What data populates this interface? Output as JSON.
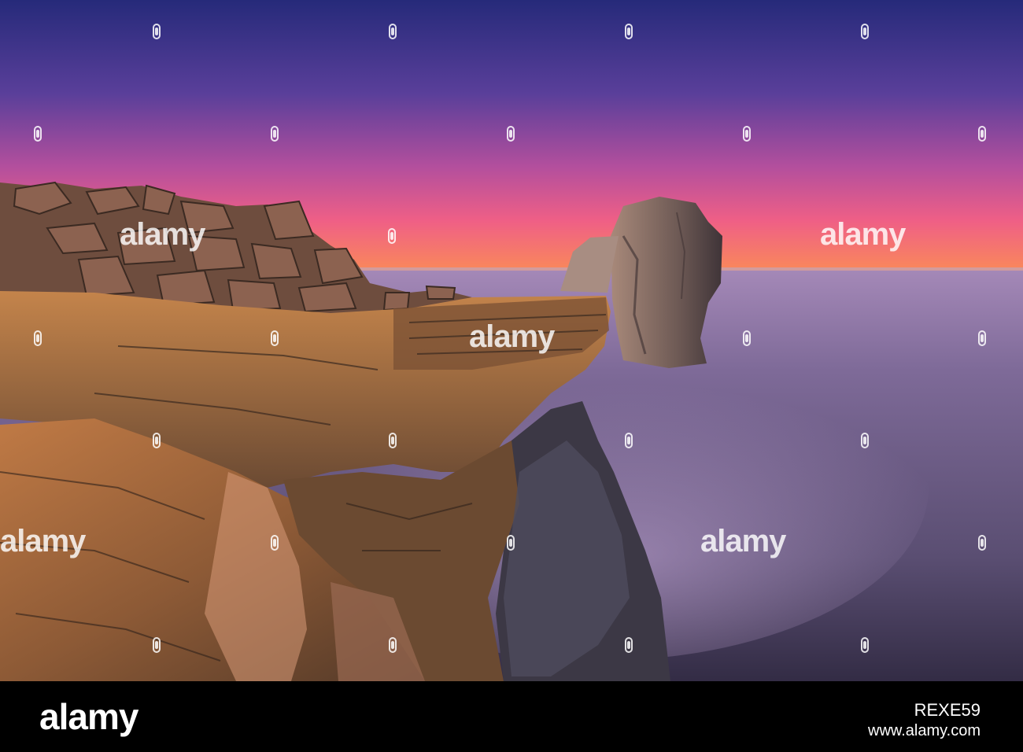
{
  "photo": {
    "subject": "sea-stack-at-sunset",
    "colors": {
      "sky_top": "#2d2a7e",
      "sky_mid": "#8a4aa8",
      "sky_horizon": "#f0637a",
      "horizon_glow": "#f7855f",
      "sea": "#6e6288",
      "sea_dark": "#3d3553",
      "rock_warm": "#b36f3a",
      "rock_shadow": "#3a2a22"
    }
  },
  "watermark": {
    "text": "alamy"
  },
  "footer": {
    "brand": "alamy",
    "image_id": "REXE59",
    "site": "www.alamy.com"
  }
}
